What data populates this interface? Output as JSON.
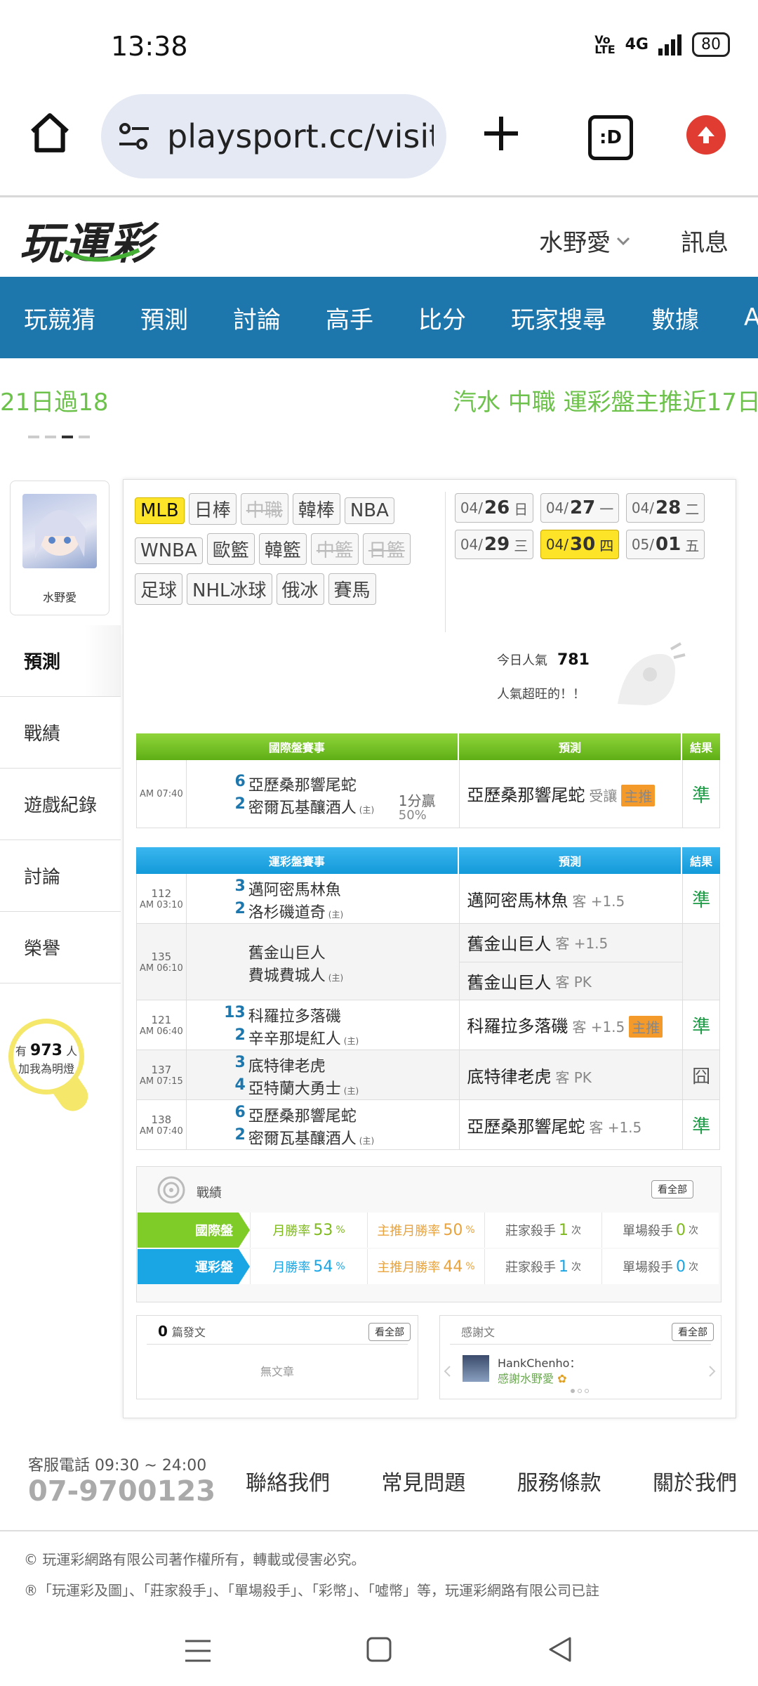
{
  "status_bar": {
    "time": "13:38",
    "network": "4G",
    "battery": "80"
  },
  "browser": {
    "url": "playsport.cc/visit",
    "tab_label": ":D"
  },
  "header": {
    "logo": "玩運彩",
    "user_name": "水野愛",
    "messages": "訊息"
  },
  "nav": [
    "玩競猜",
    "預測",
    "討論",
    "高手",
    "比分",
    "玩家搜尋",
    "數據",
    "APP"
  ],
  "ticker": {
    "left": "21日過18",
    "right": "汽水 中職 運彩盤主推近17日"
  },
  "sidebar": {
    "avatar_name": "水野愛",
    "menu": [
      "預測",
      "戰績",
      "遊戲紀錄",
      "討論",
      "榮譽"
    ],
    "fans": {
      "prefix": "有",
      "count": "973",
      "suffix": "人",
      "line2": "加我為明燈"
    }
  },
  "sports_tags": [
    {
      "label": "MLB",
      "state": "active"
    },
    {
      "label": "日棒",
      "state": "normal"
    },
    {
      "label": "中職",
      "state": "disabled"
    },
    {
      "label": "韓棒",
      "state": "normal"
    },
    {
      "label": "NBA",
      "state": "normal"
    },
    {
      "label": "WNBA",
      "state": "normal"
    },
    {
      "label": "歐籃",
      "state": "normal"
    },
    {
      "label": "韓籃",
      "state": "normal"
    },
    {
      "label": "中籃",
      "state": "disabled"
    },
    {
      "label": "日籃",
      "state": "disabled"
    },
    {
      "label": "足球",
      "state": "normal"
    },
    {
      "label": "NHL冰球",
      "state": "normal"
    },
    {
      "label": "俄冰",
      "state": "normal"
    },
    {
      "label": "賽馬",
      "state": "normal"
    }
  ],
  "dates": [
    {
      "m": "04/",
      "d": "26",
      "w": "日",
      "active": false
    },
    {
      "m": "04/",
      "d": "27",
      "w": "一",
      "active": false
    },
    {
      "m": "04/",
      "d": "28",
      "w": "二",
      "active": false
    },
    {
      "m": "04/",
      "d": "29",
      "w": "三",
      "active": false
    },
    {
      "m": "04/",
      "d": "30",
      "w": "四",
      "active": true
    },
    {
      "m": "05/",
      "d": "01",
      "w": "五",
      "active": false
    }
  ],
  "popularity": {
    "label": "今日人氣",
    "value": "781",
    "note": "人氣超旺的！！"
  },
  "intl_table": {
    "headers": [
      "國際盤賽事",
      "預測",
      "結果"
    ],
    "rows": [
      {
        "time": "AM 07:40",
        "s1": "6",
        "t1": "亞歷桑那響尾蛇",
        "s2": "2",
        "t2": "密爾瓦基釀酒人",
        "home": "(主)",
        "extra": "1分贏",
        "extra2": "50%",
        "pick": "亞歷桑那響尾蛇",
        "pick_note": "受讓",
        "badge": "主推",
        "result": "準"
      }
    ]
  },
  "lottery_table": {
    "headers": [
      "運彩盤賽事",
      "預測",
      "結果"
    ],
    "rows": [
      {
        "no": "112",
        "time": "AM 03:10",
        "s1": "3",
        "t1": "邁阿密馬林魚",
        "s2": "2",
        "t2": "洛杉磯道奇",
        "home": "(主)",
        "picks": [
          {
            "name": "邁阿密馬林魚",
            "note": "客 +1.5"
          }
        ],
        "badge": "",
        "result": "準"
      },
      {
        "no": "135",
        "time": "AM 06:10",
        "s1": "",
        "t1": "舊金山巨人",
        "s2": "",
        "t2": "費城費城人",
        "home": "(主)",
        "picks": [
          {
            "name": "舊金山巨人",
            "note": "客 +1.5"
          },
          {
            "name": "舊金山巨人",
            "note": "客 PK"
          }
        ],
        "badge": "",
        "result": ""
      },
      {
        "no": "121",
        "time": "AM 06:40",
        "s1": "13",
        "t1": "科羅拉多落磯",
        "s2": "2",
        "t2": "辛辛那堤紅人",
        "home": "(主)",
        "picks": [
          {
            "name": "科羅拉多落磯",
            "note": "客 +1.5"
          }
        ],
        "badge": "主推",
        "result": "準"
      },
      {
        "no": "137",
        "time": "AM 07:15",
        "s1": "3",
        "t1": "底特律老虎",
        "s2": "4",
        "t2": "亞特蘭大勇士",
        "home": "(主)",
        "picks": [
          {
            "name": "底特律老虎",
            "note": "客 PK"
          }
        ],
        "badge": "",
        "result": "囧"
      },
      {
        "no": "138",
        "time": "AM 07:40",
        "s1": "6",
        "t1": "亞歷桑那響尾蛇",
        "s2": "2",
        "t2": "密爾瓦基釀酒人",
        "home": "(主)",
        "picks": [
          {
            "name": "亞歷桑那響尾蛇",
            "note": "客 +1.5"
          }
        ],
        "badge": "",
        "result": "準"
      }
    ]
  },
  "record": {
    "title": "戰績",
    "view_all": "看全部",
    "rows": [
      {
        "label": "國際盤",
        "color": "#7fcc28",
        "monthly_label": "月勝率",
        "monthly": "53",
        "main_label": "主推月勝率",
        "main": "50",
        "killer_label": "莊家殺手",
        "killer": "1",
        "single_label": "單場殺手",
        "single": "0",
        "unit_pct": "%",
        "unit_times": "次"
      },
      {
        "label": "運彩盤",
        "color": "#1aa6e4",
        "monthly_label": "月勝率",
        "monthly": "54",
        "main_label": "主推月勝率",
        "main": "44",
        "killer_label": "莊家殺手",
        "killer": "1",
        "single_label": "單場殺手",
        "single": "0",
        "unit_pct": "%",
        "unit_times": "次"
      }
    ]
  },
  "posts": {
    "count": "0",
    "label": "篇發文",
    "view_all": "看全部",
    "empty": "無文章"
  },
  "thanks": {
    "title": "感謝文",
    "view_all": "看全部",
    "user": "HankChenho：",
    "text": "感謝水野愛"
  },
  "footer": {
    "hotline_label": "客服電話 09:30 ~ 24:00",
    "hotline": "07-9700123",
    "links": [
      "聯絡我們",
      "常見問題",
      "服務條款",
      "關於我們"
    ],
    "copyright": "© 玩運彩網路有限公司著作權所有，轉載或侵害必究。",
    "trademark": "®「玩運彩及圖」、「莊家殺手」、「單場殺手」、「彩幣」、「噓幣」等，玩運彩網路有限公司已註"
  }
}
